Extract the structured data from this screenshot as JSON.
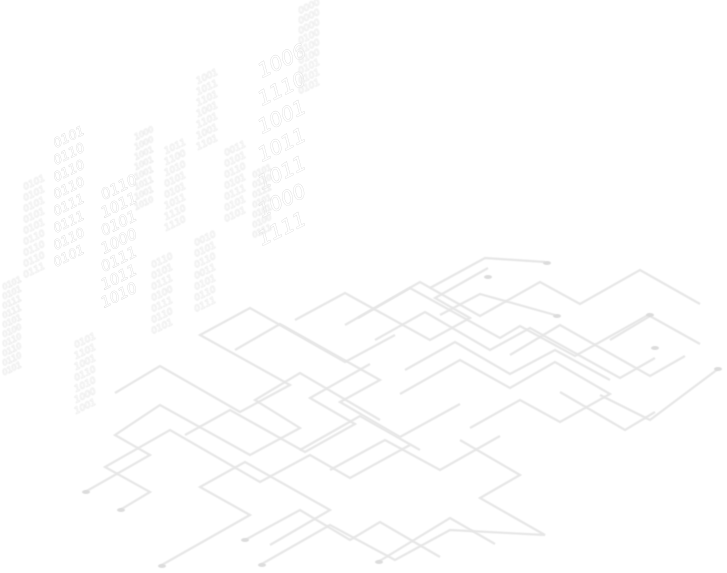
{
  "illustration": {
    "subject": "isometric-binary-code-and-circuit-traces",
    "colors": {
      "background": "#ffffff",
      "glyph_fill": "#ffffff",
      "glyph_outline": "#c9c9c9",
      "trace": "#e6e6e6",
      "pad": "#dcdcdc"
    },
    "code_columns": [
      {
        "words": [
          "1006",
          "1110",
          "1001",
          "1011",
          "1011",
          "1000",
          "1111"
        ]
      },
      {
        "words": [
          "0000",
          "0000",
          "0000",
          "0100",
          "0100",
          "0100",
          "0101",
          "0101",
          "0101"
        ]
      },
      {
        "words": [
          "0110",
          "1011",
          "0101",
          "1000",
          "0111",
          "1011",
          "1010"
        ]
      },
      {
        "words": [
          "0101",
          "0110",
          "0110",
          "0110",
          "0111",
          "0111",
          "0110",
          "0101"
        ]
      },
      {
        "words": [
          "0101",
          "0101",
          "0101",
          "0101",
          "0101",
          "0110",
          "0110",
          "0110",
          "0111"
        ]
      },
      {
        "words": [
          "0101",
          "0101",
          "0111",
          "0111",
          "0101",
          "0100",
          "0110",
          "0110",
          "0110",
          "0101"
        ]
      },
      {
        "words": [
          "0101",
          "1101",
          "1001",
          "0110",
          "1010",
          "1000",
          "1001"
        ]
      },
      {
        "words": [
          "0110",
          "0101",
          "0111",
          "0100",
          "0111",
          "0110",
          "0101"
        ]
      },
      {
        "words": [
          "1011",
          "1100",
          "1010",
          "0101",
          "0101",
          "1011",
          "1110",
          "1110"
        ]
      },
      {
        "words": [
          "1001",
          "1011",
          "1101",
          "1001",
          "1101",
          "1001",
          "1101"
        ]
      },
      {
        "words": [
          "0010",
          "0101",
          "0110",
          "0011",
          "0101",
          "0110",
          "0111"
        ]
      },
      {
        "words": [
          "0011",
          "0101",
          "0110",
          "0101",
          "0111",
          "0101",
          "0101"
        ]
      },
      {
        "words": [
          "1000",
          "1000",
          "1001",
          "1001",
          "1001",
          "1011",
          "1001",
          "1010"
        ]
      },
      {
        "words": [
          "0101",
          "0110",
          "0111",
          "0101",
          "0101",
          "0100",
          "0111"
        ]
      }
    ]
  }
}
